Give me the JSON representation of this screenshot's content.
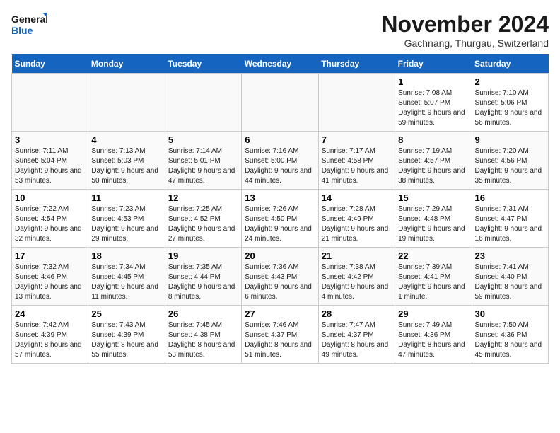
{
  "logo": {
    "line1": "General",
    "line2": "Blue"
  },
  "title": "November 2024",
  "location": "Gachnang, Thurgau, Switzerland",
  "days_of_week": [
    "Sunday",
    "Monday",
    "Tuesday",
    "Wednesday",
    "Thursday",
    "Friday",
    "Saturday"
  ],
  "weeks": [
    [
      {
        "day": "",
        "info": "",
        "empty": true
      },
      {
        "day": "",
        "info": "",
        "empty": true
      },
      {
        "day": "",
        "info": "",
        "empty": true
      },
      {
        "day": "",
        "info": "",
        "empty": true
      },
      {
        "day": "",
        "info": "",
        "empty": true
      },
      {
        "day": "1",
        "info": "Sunrise: 7:08 AM\nSunset: 5:07 PM\nDaylight: 9 hours and 59 minutes."
      },
      {
        "day": "2",
        "info": "Sunrise: 7:10 AM\nSunset: 5:06 PM\nDaylight: 9 hours and 56 minutes."
      }
    ],
    [
      {
        "day": "3",
        "info": "Sunrise: 7:11 AM\nSunset: 5:04 PM\nDaylight: 9 hours and 53 minutes."
      },
      {
        "day": "4",
        "info": "Sunrise: 7:13 AM\nSunset: 5:03 PM\nDaylight: 9 hours and 50 minutes."
      },
      {
        "day": "5",
        "info": "Sunrise: 7:14 AM\nSunset: 5:01 PM\nDaylight: 9 hours and 47 minutes."
      },
      {
        "day": "6",
        "info": "Sunrise: 7:16 AM\nSunset: 5:00 PM\nDaylight: 9 hours and 44 minutes."
      },
      {
        "day": "7",
        "info": "Sunrise: 7:17 AM\nSunset: 4:58 PM\nDaylight: 9 hours and 41 minutes."
      },
      {
        "day": "8",
        "info": "Sunrise: 7:19 AM\nSunset: 4:57 PM\nDaylight: 9 hours and 38 minutes."
      },
      {
        "day": "9",
        "info": "Sunrise: 7:20 AM\nSunset: 4:56 PM\nDaylight: 9 hours and 35 minutes."
      }
    ],
    [
      {
        "day": "10",
        "info": "Sunrise: 7:22 AM\nSunset: 4:54 PM\nDaylight: 9 hours and 32 minutes."
      },
      {
        "day": "11",
        "info": "Sunrise: 7:23 AM\nSunset: 4:53 PM\nDaylight: 9 hours and 29 minutes."
      },
      {
        "day": "12",
        "info": "Sunrise: 7:25 AM\nSunset: 4:52 PM\nDaylight: 9 hours and 27 minutes."
      },
      {
        "day": "13",
        "info": "Sunrise: 7:26 AM\nSunset: 4:50 PM\nDaylight: 9 hours and 24 minutes."
      },
      {
        "day": "14",
        "info": "Sunrise: 7:28 AM\nSunset: 4:49 PM\nDaylight: 9 hours and 21 minutes."
      },
      {
        "day": "15",
        "info": "Sunrise: 7:29 AM\nSunset: 4:48 PM\nDaylight: 9 hours and 19 minutes."
      },
      {
        "day": "16",
        "info": "Sunrise: 7:31 AM\nSunset: 4:47 PM\nDaylight: 9 hours and 16 minutes."
      }
    ],
    [
      {
        "day": "17",
        "info": "Sunrise: 7:32 AM\nSunset: 4:46 PM\nDaylight: 9 hours and 13 minutes."
      },
      {
        "day": "18",
        "info": "Sunrise: 7:34 AM\nSunset: 4:45 PM\nDaylight: 9 hours and 11 minutes."
      },
      {
        "day": "19",
        "info": "Sunrise: 7:35 AM\nSunset: 4:44 PM\nDaylight: 9 hours and 8 minutes."
      },
      {
        "day": "20",
        "info": "Sunrise: 7:36 AM\nSunset: 4:43 PM\nDaylight: 9 hours and 6 minutes."
      },
      {
        "day": "21",
        "info": "Sunrise: 7:38 AM\nSunset: 4:42 PM\nDaylight: 9 hours and 4 minutes."
      },
      {
        "day": "22",
        "info": "Sunrise: 7:39 AM\nSunset: 4:41 PM\nDaylight: 9 hours and 1 minute."
      },
      {
        "day": "23",
        "info": "Sunrise: 7:41 AM\nSunset: 4:40 PM\nDaylight: 8 hours and 59 minutes."
      }
    ],
    [
      {
        "day": "24",
        "info": "Sunrise: 7:42 AM\nSunset: 4:39 PM\nDaylight: 8 hours and 57 minutes."
      },
      {
        "day": "25",
        "info": "Sunrise: 7:43 AM\nSunset: 4:39 PM\nDaylight: 8 hours and 55 minutes."
      },
      {
        "day": "26",
        "info": "Sunrise: 7:45 AM\nSunset: 4:38 PM\nDaylight: 8 hours and 53 minutes."
      },
      {
        "day": "27",
        "info": "Sunrise: 7:46 AM\nSunset: 4:37 PM\nDaylight: 8 hours and 51 minutes."
      },
      {
        "day": "28",
        "info": "Sunrise: 7:47 AM\nSunset: 4:37 PM\nDaylight: 8 hours and 49 minutes."
      },
      {
        "day": "29",
        "info": "Sunrise: 7:49 AM\nSunset: 4:36 PM\nDaylight: 8 hours and 47 minutes."
      },
      {
        "day": "30",
        "info": "Sunrise: 7:50 AM\nSunset: 4:36 PM\nDaylight: 8 hours and 45 minutes."
      }
    ]
  ]
}
